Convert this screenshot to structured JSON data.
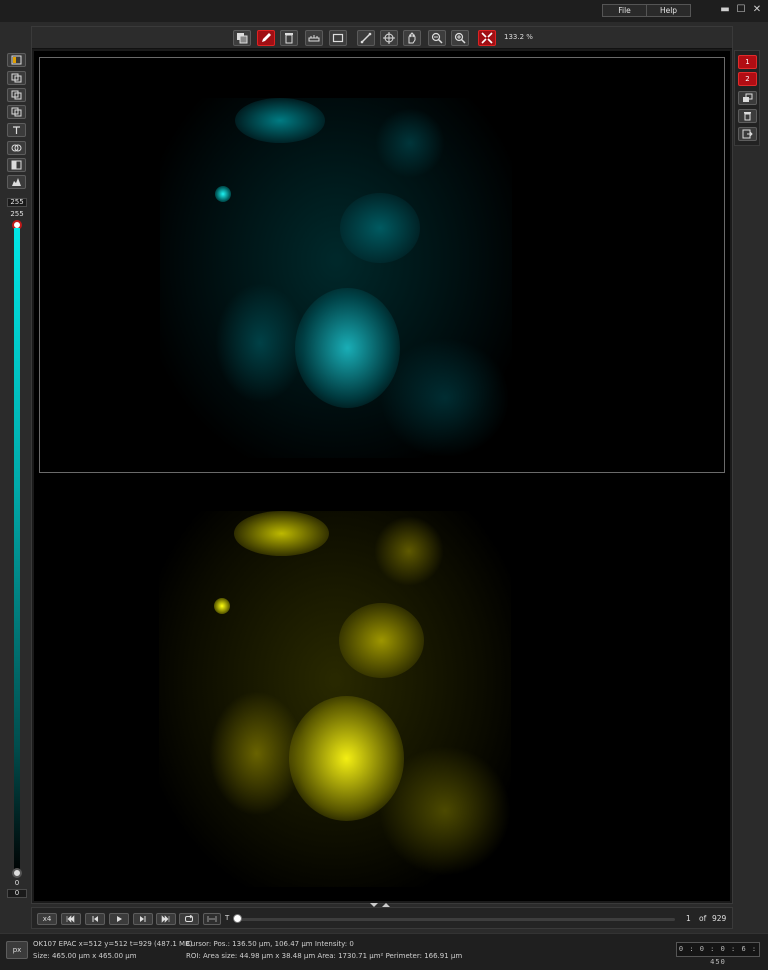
{
  "menu": {
    "file": "File",
    "help": "Help"
  },
  "window_controls": {
    "minimize": "▬",
    "maximize": "☐",
    "close": "✕"
  },
  "toolbar": {
    "zoom": "133.2 %"
  },
  "display_range": {
    "max_box": "255",
    "max_label": "255",
    "min_label": "0",
    "min_box": "0"
  },
  "channels": [
    {
      "label": "1"
    },
    {
      "label": "2"
    }
  ],
  "colors": {
    "channel1": "#00e0e0",
    "channel2": "#f0ea00",
    "active": "#b10d13"
  },
  "playback": {
    "speed": "x4",
    "t_label": "T",
    "current": "1",
    "of": "of",
    "total": "929"
  },
  "status": {
    "px": "px",
    "info_line": "OK107 EPAC x=512 y=512 t=929  (487.1 MB)",
    "size_line": "Size: 465.00 µm x 465.00 µm",
    "cursor_line": "Cursor:  Pos.: 136.50 µm, 106.47 µm     Intensity: 0",
    "roi_line": "ROI:  Area size: 44.98 µm x 38.48 µm     Area: 1730.71 µm²     Perimeter: 166.91 µm",
    "timer": "0 : 0 : 0 : 6 : 450"
  }
}
